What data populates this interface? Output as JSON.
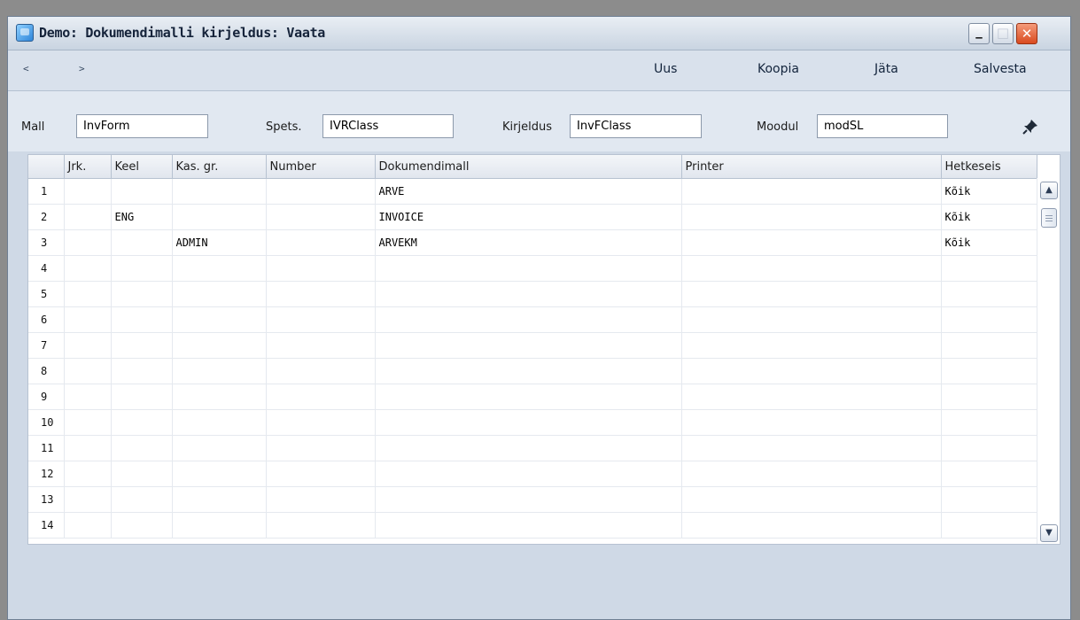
{
  "window": {
    "title": "Demo: Dokumendimalli kirjeldus: Vaata",
    "controls": {
      "minimize": "_",
      "maximize": "□",
      "close": "✕"
    }
  },
  "toolbar": {
    "prev": "<",
    "next": ">",
    "new_label": "Uus",
    "copy_label": "Koopia",
    "leave_label": "Jäta",
    "save_label": "Salvesta"
  },
  "header": {
    "mall": {
      "label": "Mall",
      "value": "InvForm"
    },
    "spets": {
      "label": "Spets.",
      "value": "IVRClass"
    },
    "kirjeldus": {
      "label": "Kirjeldus",
      "value": "InvFClass"
    },
    "moodul": {
      "label": "Moodul",
      "value": "modSL"
    },
    "pin_icon": "pushpin-icon"
  },
  "grid": {
    "columns": [
      "",
      "Jrk.",
      "Keel",
      "Kas. gr.",
      "Number",
      "Dokumendimall",
      "Printer",
      "Hetkeseis"
    ],
    "rows": [
      {
        "n": "1",
        "jrk": "",
        "keel": "",
        "kasgr": "",
        "number": "",
        "dokumendimall": "ARVE",
        "printer": "",
        "hetkeseis": "Kõik"
      },
      {
        "n": "2",
        "jrk": "",
        "keel": "ENG",
        "kasgr": "",
        "number": "",
        "dokumendimall": "INVOICE",
        "printer": "",
        "hetkeseis": "Kõik"
      },
      {
        "n": "3",
        "jrk": "",
        "keel": "",
        "kasgr": "ADMIN",
        "number": "",
        "dokumendimall": "ARVEKM",
        "printer": "",
        "hetkeseis": "Kõik"
      },
      {
        "n": "4",
        "jrk": "",
        "keel": "",
        "kasgr": "",
        "number": "",
        "dokumendimall": "",
        "printer": "",
        "hetkeseis": ""
      },
      {
        "n": "5",
        "jrk": "",
        "keel": "",
        "kasgr": "",
        "number": "",
        "dokumendimall": "",
        "printer": "",
        "hetkeseis": ""
      },
      {
        "n": "6",
        "jrk": "",
        "keel": "",
        "kasgr": "",
        "number": "",
        "dokumendimall": "",
        "printer": "",
        "hetkeseis": ""
      },
      {
        "n": "7",
        "jrk": "",
        "keel": "",
        "kasgr": "",
        "number": "",
        "dokumendimall": "",
        "printer": "",
        "hetkeseis": ""
      },
      {
        "n": "8",
        "jrk": "",
        "keel": "",
        "kasgr": "",
        "number": "",
        "dokumendimall": "",
        "printer": "",
        "hetkeseis": ""
      },
      {
        "n": "9",
        "jrk": "",
        "keel": "",
        "kasgr": "",
        "number": "",
        "dokumendimall": "",
        "printer": "",
        "hetkeseis": ""
      },
      {
        "n": "10",
        "jrk": "",
        "keel": "",
        "kasgr": "",
        "number": "",
        "dokumendimall": "",
        "printer": "",
        "hetkeseis": ""
      },
      {
        "n": "11",
        "jrk": "",
        "keel": "",
        "kasgr": "",
        "number": "",
        "dokumendimall": "",
        "printer": "",
        "hetkeseis": ""
      },
      {
        "n": "12",
        "jrk": "",
        "keel": "",
        "kasgr": "",
        "number": "",
        "dokumendimall": "",
        "printer": "",
        "hetkeseis": ""
      },
      {
        "n": "13",
        "jrk": "",
        "keel": "",
        "kasgr": "",
        "number": "",
        "dokumendimall": "",
        "printer": "",
        "hetkeseis": ""
      },
      {
        "n": "14",
        "jrk": "",
        "keel": "",
        "kasgr": "",
        "number": "",
        "dokumendimall": "",
        "printer": "",
        "hetkeseis": ""
      }
    ]
  },
  "scrollbar": {
    "up": "▲",
    "down": "▼"
  }
}
